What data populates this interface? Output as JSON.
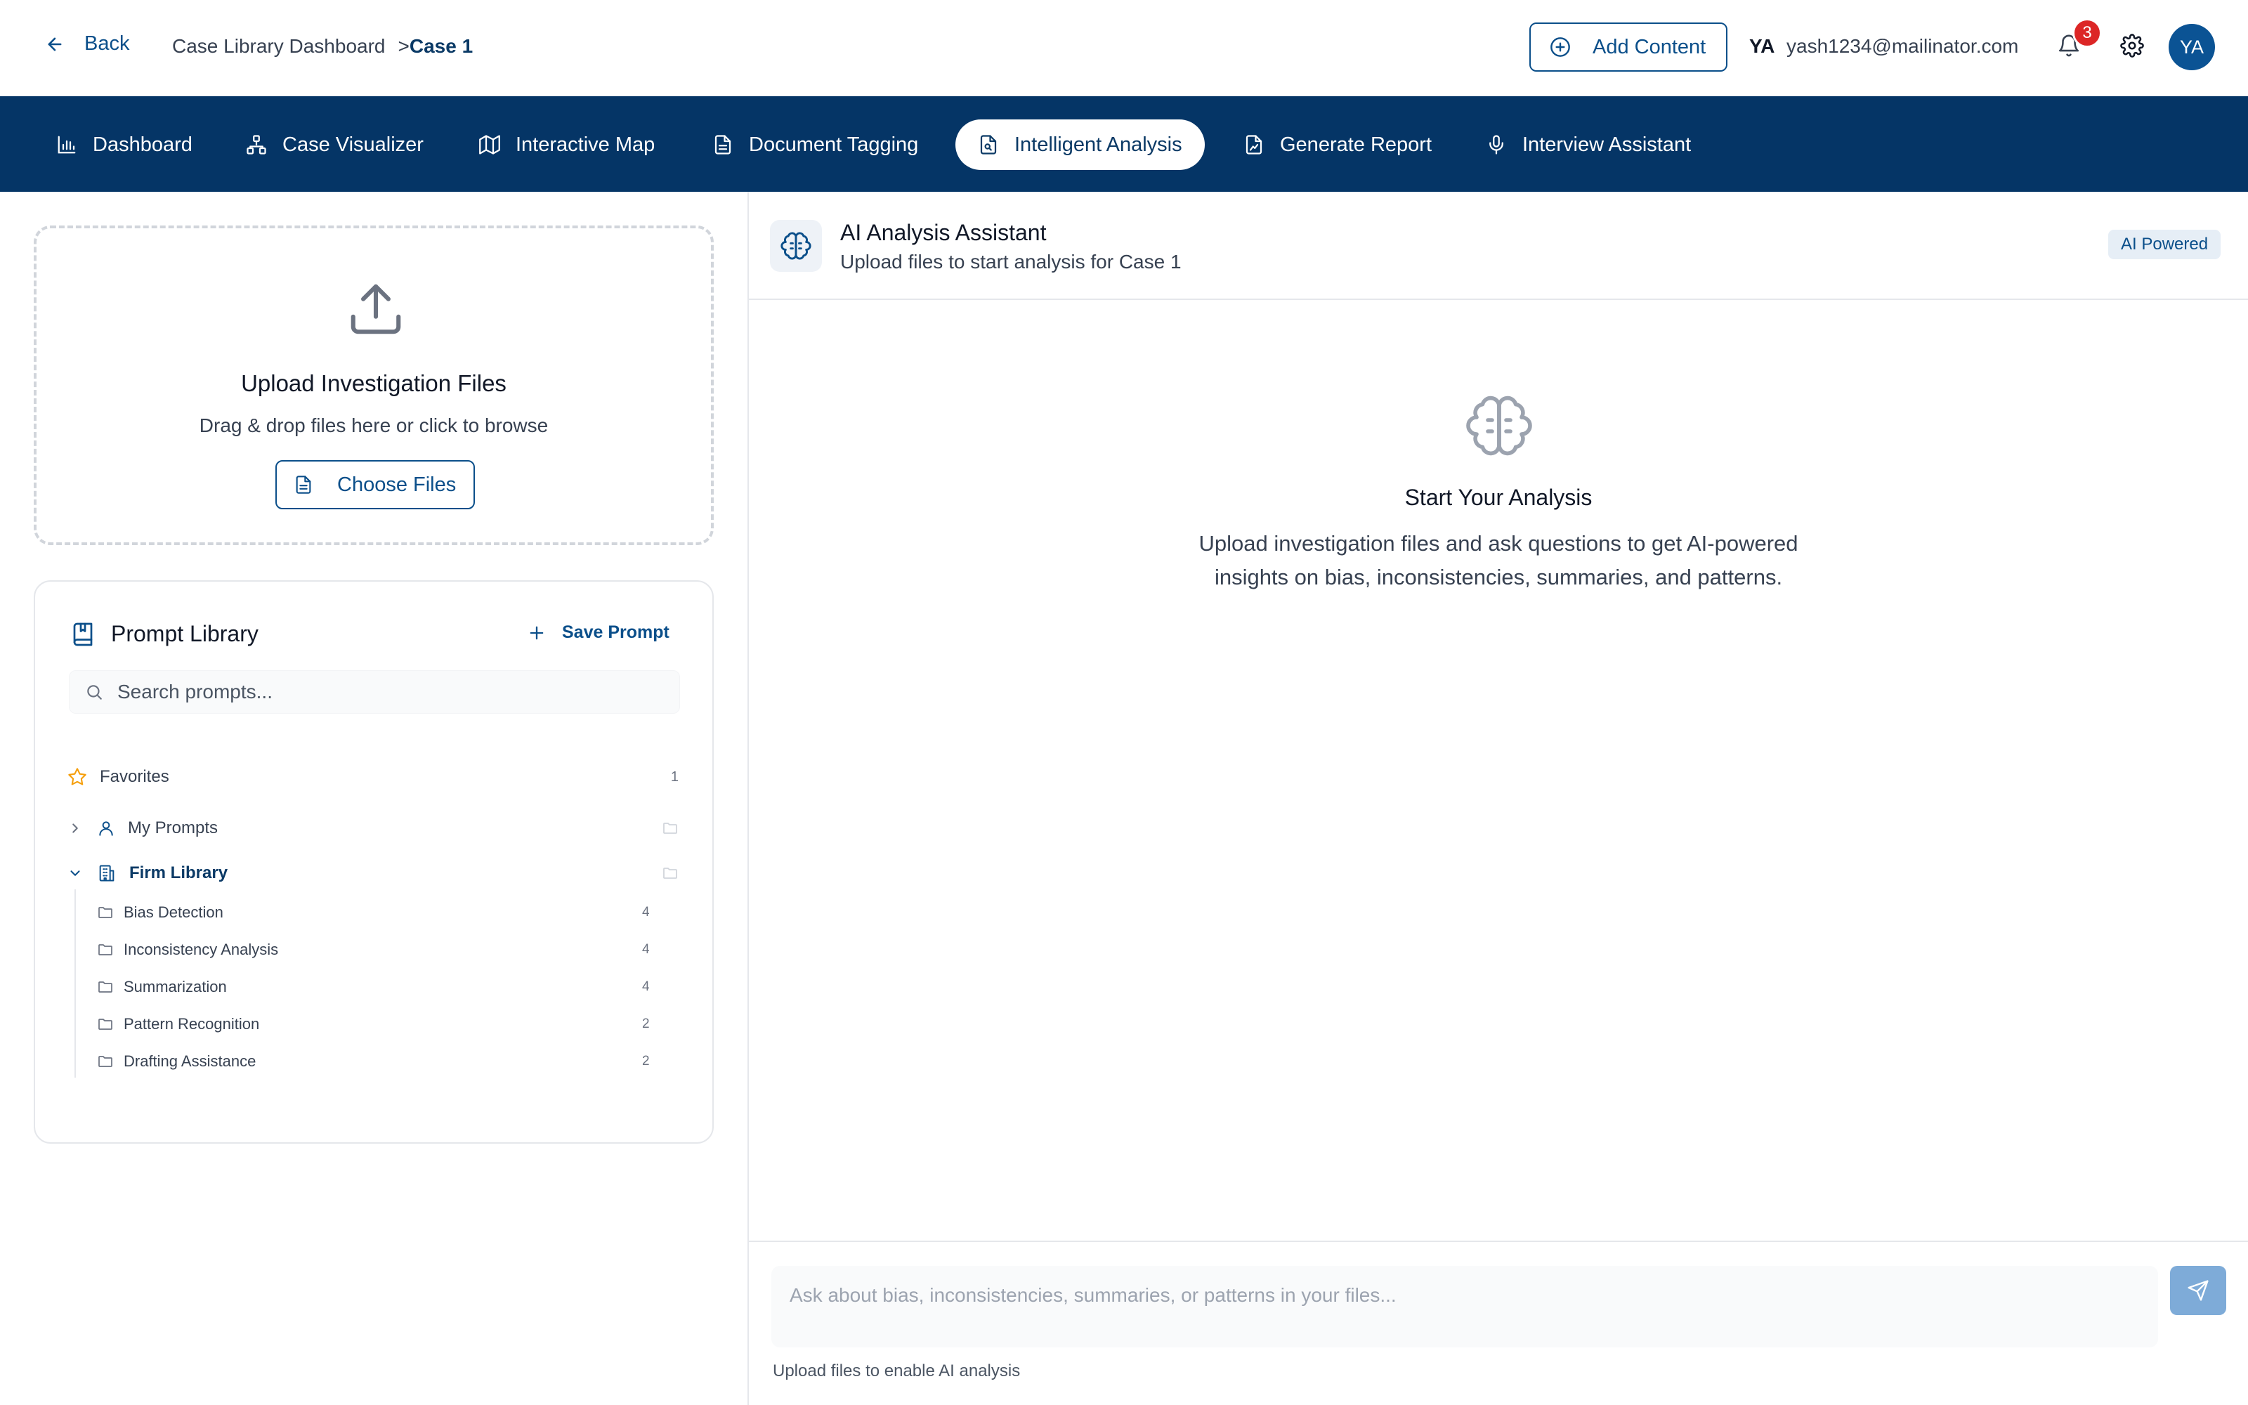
{
  "header": {
    "back_label": "Back",
    "breadcrumb_root": "Case Library Dashboard",
    "breadcrumb_sep": ">",
    "breadcrumb_current": "Case 1",
    "add_content_label": "Add Content",
    "user_initials": "YA",
    "user_email": "yash1234@mailinator.com",
    "notification_count": "3",
    "avatar_initials": "YA"
  },
  "nav": {
    "items": [
      {
        "label": "Dashboard",
        "icon": "bar-chart-icon"
      },
      {
        "label": "Case Visualizer",
        "icon": "network-icon"
      },
      {
        "label": "Interactive Map",
        "icon": "map-icon"
      },
      {
        "label": "Document Tagging",
        "icon": "document-icon"
      },
      {
        "label": "Intelligent Analysis",
        "icon": "file-search-icon",
        "active": true
      },
      {
        "label": "Generate Report",
        "icon": "file-chart-icon"
      },
      {
        "label": "Interview Assistant",
        "icon": "microphone-icon"
      }
    ]
  },
  "upload": {
    "title": "Upload Investigation Files",
    "subtitle": "Drag & drop files here or click to browse",
    "button_label": "Choose Files"
  },
  "library": {
    "title": "Prompt Library",
    "save_label": "Save Prompt",
    "search_placeholder": "Search prompts...",
    "favorites_label": "Favorites",
    "favorites_count": "1",
    "my_prompts_label": "My Prompts",
    "firm_library_label": "Firm Library",
    "folders": [
      {
        "label": "Bias Detection",
        "count": "4"
      },
      {
        "label": "Inconsistency Analysis",
        "count": "4"
      },
      {
        "label": "Summarization",
        "count": "4"
      },
      {
        "label": "Pattern Recognition",
        "count": "2"
      },
      {
        "label": "Drafting Assistance",
        "count": "2"
      }
    ]
  },
  "assistant": {
    "title": "AI Analysis Assistant",
    "subtitle": "Upload files to start analysis for Case 1",
    "badge": "AI Powered",
    "empty_title": "Start Your Analysis",
    "empty_desc": "Upload investigation files and ask questions to get AI-powered insights on bias, inconsistencies, summaries, and patterns.",
    "input_placeholder": "Ask about bias, inconsistencies, summaries, or patterns in your files...",
    "input_hint": "Upload files to enable AI analysis"
  },
  "colors": {
    "primary": "#053566",
    "accent": "#0b4f8a",
    "badge_red": "#dc2626",
    "star": "#f59e0b"
  }
}
